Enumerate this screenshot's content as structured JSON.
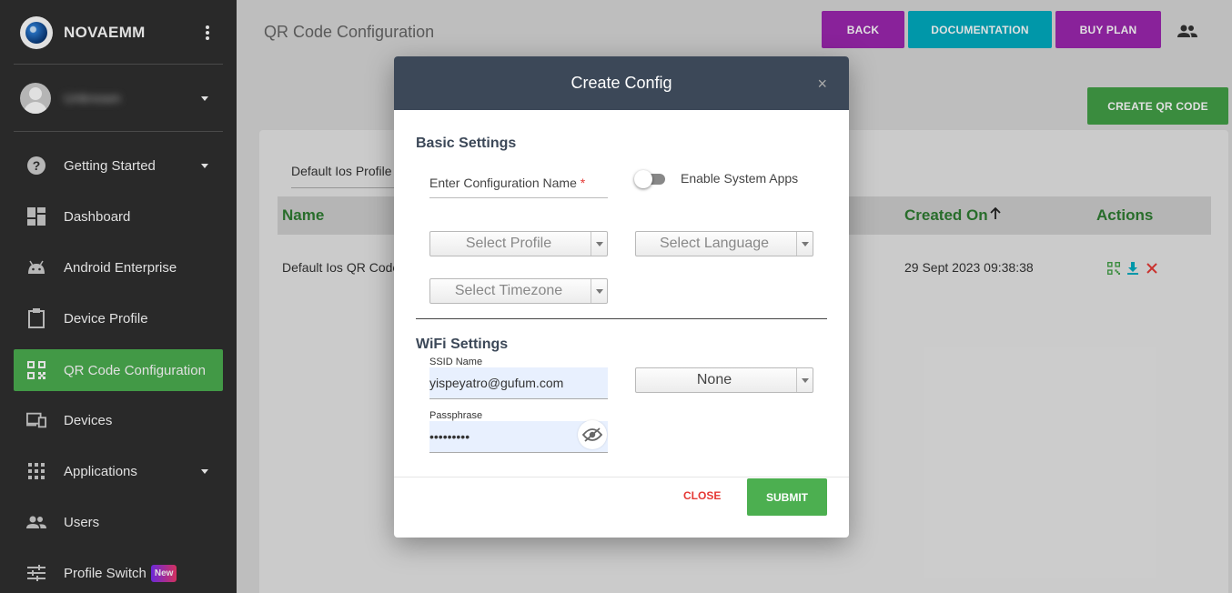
{
  "brand": {
    "name": "NOVAEMM"
  },
  "user": {
    "name": "Unknown"
  },
  "sidebar": {
    "items": [
      {
        "label": "Getting Started"
      },
      {
        "label": "Dashboard"
      },
      {
        "label": "Android Enterprise"
      },
      {
        "label": "Device Profile"
      },
      {
        "label": "QR Code Configuration"
      },
      {
        "label": "Devices"
      },
      {
        "label": "Applications"
      },
      {
        "label": "Users"
      },
      {
        "label": "Profile Switch",
        "badge": "New"
      }
    ]
  },
  "header": {
    "title": "QR Code Configuration",
    "back_label": "BACK",
    "documentation_label": "DOCUMENTATION",
    "buy_plan_label": "BUY PLAN",
    "create_qr_label": "CREATE QR CODE"
  },
  "table": {
    "tab_label": "Default Ios Profile",
    "headers": {
      "name": "Name",
      "created_on": "Created On",
      "actions": "Actions"
    },
    "rows": [
      {
        "name": "Default Ios QR Code",
        "created_on": "29 Sept 2023 09:38:38"
      }
    ]
  },
  "modal": {
    "title": "Create Config",
    "close_x": "×",
    "basic_settings_title": "Basic Settings",
    "config_name_label": "Enter Configuration Name",
    "required_mark": "*",
    "enable_system_apps_label": "Enable System Apps",
    "enable_system_apps_on": false,
    "select_profile": "Select Profile",
    "select_language": "Select Language",
    "select_timezone": "Select Timezone",
    "wifi_settings_title": "WiFi Settings",
    "ssid_label": "SSID Name",
    "ssid_value": "yispeyatro@gufum.com",
    "security_value": "None",
    "passphrase_label": "Passphrase",
    "passphrase_value": "•••••••••",
    "close_label": "CLOSE",
    "submit_label": "SUBMIT"
  },
  "colors": {
    "sidebar_bg": "#2f2f2f",
    "active_green": "#4caf50",
    "purple": "#9c27b0",
    "cyan": "#00acc1",
    "modal_header": "#3c4858",
    "table_header_text": "#2e7d32",
    "danger": "#e53935"
  }
}
